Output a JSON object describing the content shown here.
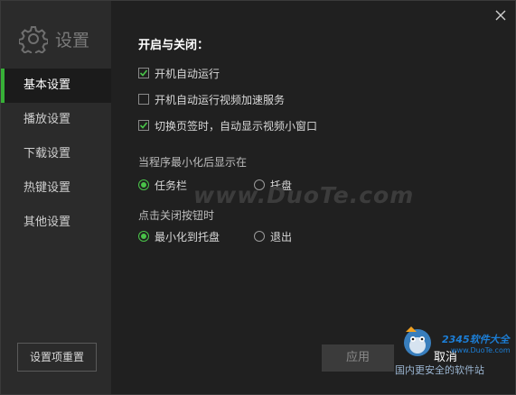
{
  "app": {
    "title": "设置"
  },
  "sidebar": {
    "items": [
      {
        "label": "基本设置",
        "active": true
      },
      {
        "label": "播放设置",
        "active": false
      },
      {
        "label": "下载设置",
        "active": false
      },
      {
        "label": "热键设置",
        "active": false
      },
      {
        "label": "其他设置",
        "active": false
      }
    ],
    "reset_label": "设置项重置"
  },
  "main": {
    "section_title": "开启与关闭：",
    "options": [
      {
        "label": "开机自动运行",
        "checked": true
      },
      {
        "label": "开机自动运行视频加速服务",
        "checked": false
      },
      {
        "label": "切换页签时，自动显示视频小窗口",
        "checked": true
      }
    ],
    "minimize_group": {
      "label": "当程序最小化后显示在",
      "options": [
        {
          "label": "任务栏",
          "selected": true
        },
        {
          "label": "托盘",
          "selected": false
        }
      ]
    },
    "close_group": {
      "label": "点击关闭按钮时",
      "options": [
        {
          "label": "最小化到托盘",
          "selected": true
        },
        {
          "label": "退出",
          "selected": false
        }
      ]
    }
  },
  "footer": {
    "apply_label": "应用",
    "cancel_label": "取消"
  },
  "watermarks": {
    "duote": "www.DuoTe.com",
    "brand_main": "2345软件大全",
    "brand_url": "www.DuoTe.com",
    "brand_slogan": "国内更安全的软件站"
  },
  "colors": {
    "accent": "#37b137",
    "background": "#202020",
    "sidebar": "#2b2b2b"
  },
  "icons": {
    "logo": "gear-icon",
    "close": "close-icon",
    "check": "check-icon"
  }
}
